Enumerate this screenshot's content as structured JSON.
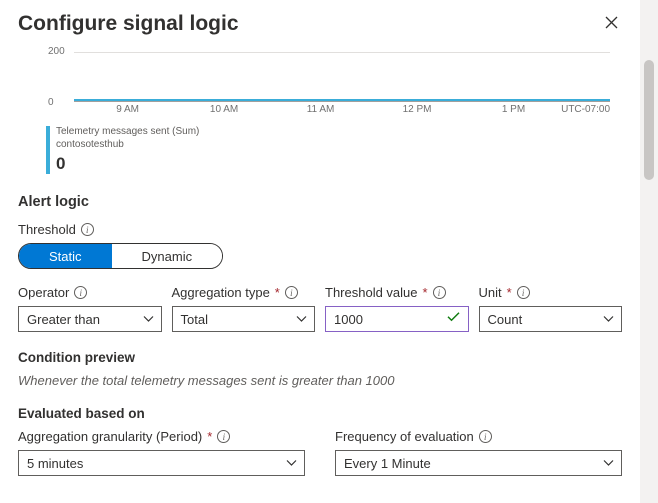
{
  "header": {
    "title": "Configure signal logic"
  },
  "chart_data": {
    "type": "line",
    "y_ticks": [
      "200",
      "0"
    ],
    "x_ticks": [
      "9 AM",
      "10 AM",
      "11 AM",
      "12 PM",
      "1 PM"
    ],
    "timezone": "UTC-07:00",
    "series": [
      {
        "name": "Telemetry messages sent (Sum)",
        "resource": "contosotesthub",
        "value": "0"
      }
    ],
    "ylim": [
      0,
      200
    ]
  },
  "alert_logic": {
    "section_title": "Alert logic",
    "threshold_label": "Threshold",
    "toggle": {
      "static": "Static",
      "dynamic": "Dynamic",
      "active": "static"
    },
    "operator": {
      "label": "Operator",
      "value": "Greater than"
    },
    "aggregation_type": {
      "label": "Aggregation type",
      "value": "Total"
    },
    "threshold_value": {
      "label": "Threshold value",
      "value": "1000"
    },
    "unit": {
      "label": "Unit",
      "value": "Count"
    }
  },
  "condition_preview": {
    "title": "Condition preview",
    "text": "Whenever the total telemetry messages sent is greater than 1000"
  },
  "evaluated": {
    "title": "Evaluated based on",
    "granularity": {
      "label": "Aggregation granularity (Period)",
      "value": "5 minutes"
    },
    "frequency": {
      "label": "Frequency of evaluation",
      "value": "Every 1 Minute"
    }
  }
}
